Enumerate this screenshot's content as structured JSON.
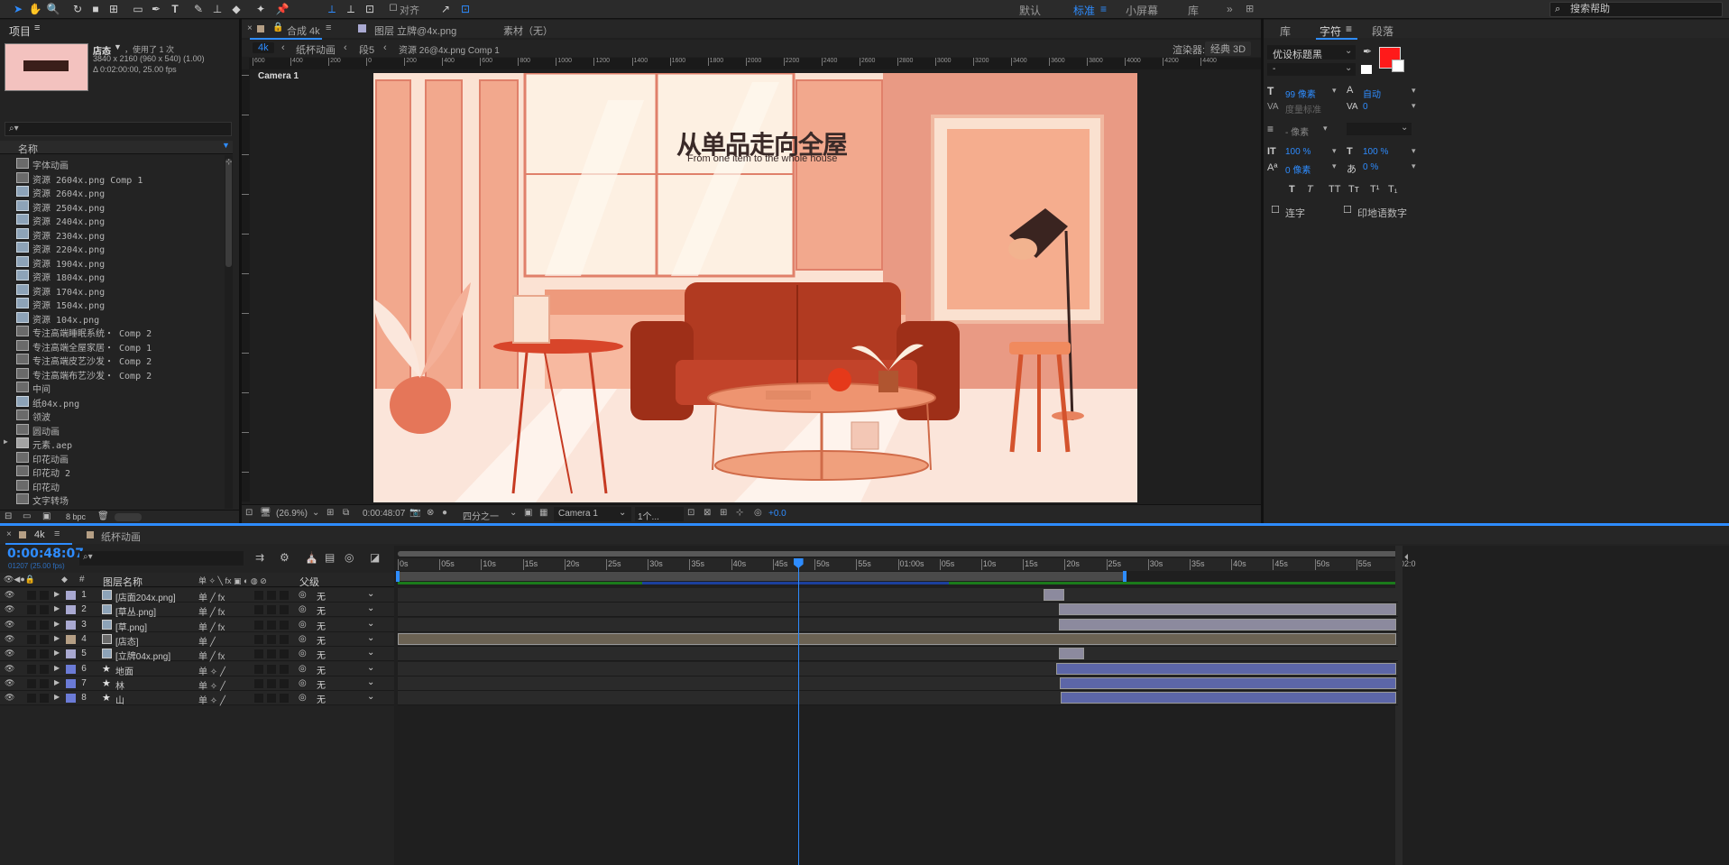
{
  "toolbar": {
    "snap_label": "对齐",
    "workspaces": [
      "默认",
      "标准",
      "小屏幕",
      "库"
    ],
    "active_workspace": "标准",
    "help_placeholder": "搜索帮助"
  },
  "project": {
    "title": "项目",
    "item_name": "店态",
    "usage": "，使用了 1 次",
    "dimensions": "3840 x 2160 (960 x 540) (1.00)",
    "duration": "Δ 0:02:00:00, 25.00 fps",
    "col_name": "名称",
    "bpc": "8 bpc",
    "items": [
      {
        "name": "字体动画",
        "type": "comp"
      },
      {
        "name": "资源 2604x.png Comp 1",
        "type": "comp"
      },
      {
        "name": "资源 2604x.png",
        "type": "img"
      },
      {
        "name": "资源 2504x.png",
        "type": "img"
      },
      {
        "name": "资源 2404x.png",
        "type": "img"
      },
      {
        "name": "资源 2304x.png",
        "type": "img"
      },
      {
        "name": "资源 2204x.png",
        "type": "img"
      },
      {
        "name": "资源 1904x.png",
        "type": "img"
      },
      {
        "name": "资源 1804x.png",
        "type": "img"
      },
      {
        "name": "资源 1704x.png",
        "type": "img"
      },
      {
        "name": "资源 1504x.png",
        "type": "img"
      },
      {
        "name": "资源 104x.png",
        "type": "img"
      },
      {
        "name": "专注高端睡眠系统・ Comp 2",
        "type": "comp"
      },
      {
        "name": "专注高端全屋家居・ Comp 1",
        "type": "comp"
      },
      {
        "name": "专注高端皮艺沙发・ Comp 2",
        "type": "comp"
      },
      {
        "name": "专注高端布艺沙发・ Comp 2",
        "type": "comp"
      },
      {
        "name": "中间",
        "type": "comp"
      },
      {
        "name": "纸04x.png",
        "type": "img"
      },
      {
        "name": "领波",
        "type": "comp"
      },
      {
        "name": "圆动画",
        "type": "comp"
      },
      {
        "name": "元素.aep",
        "type": "folder"
      },
      {
        "name": "印花动画",
        "type": "comp"
      },
      {
        "name": "印花动 2",
        "type": "comp"
      },
      {
        "name": "印花动",
        "type": "comp"
      },
      {
        "name": "文字转场",
        "type": "comp"
      }
    ]
  },
  "viewer": {
    "comp_tab": "合成 4k",
    "layer_tab": "图层 立牌@4x.png",
    "footage_tab": "素材（无）",
    "breadcrumbs": [
      "4k",
      "纸杯动画",
      "段5",
      "资源 26@4x.png Comp 1"
    ],
    "renderer_label": "渲染器:",
    "renderer_value": "经典 3D",
    "camera_label": "Camera 1",
    "ruler_h": [
      "600",
      "400",
      "200",
      "0",
      "200",
      "400",
      "600",
      "800",
      "1000",
      "1200",
      "1400",
      "1600",
      "1800",
      "2000",
      "2200",
      "2400",
      "2600",
      "2800",
      "3000",
      "3200",
      "3400",
      "3600",
      "3800",
      "4000",
      "4200",
      "4400"
    ],
    "ruler_v": [
      "0",
      "200",
      "400",
      "600",
      "800",
      "1000",
      "1200",
      "1400",
      "1600",
      "1800",
      "2000"
    ],
    "canvas_title": "从单品走向全屋",
    "canvas_subtitle": "From one item to the whole house",
    "zoom": "(26.9%)",
    "timecode": "0:00:48:07",
    "resolution": "四分之一",
    "view_camera": "Camera 1",
    "views": "1个...",
    "exposure": "+0.0"
  },
  "right_panel": {
    "tabs": [
      "库",
      "字符",
      "段落"
    ],
    "font": "优设标题黑",
    "font_style": "-",
    "font_size": "99 像素",
    "leading": "自动",
    "kerning": "度量标准",
    "tracking": "0",
    "stroke": "- 像素",
    "v_scale": "100 %",
    "h_scale": "100 %",
    "baseline": "0 像素",
    "tsume": "0 %",
    "styles": [
      "T",
      "T",
      "TT",
      "Tт",
      "T¹",
      "T₁"
    ],
    "ligatures": "连字",
    "hindi_digits": "印地语数字",
    "fill_color": "#ff1a1a"
  },
  "timeline": {
    "tabs": [
      "4k",
      "纸杯动画"
    ],
    "timecode": "0:00:48:07",
    "frame_info": "01207 (25.00 fps)",
    "col_num": "#",
    "col_name": "图层名称",
    "col_switches": "单 ✧ ╲ fx ▣ ◐ ◍ ⊘",
    "col_parent": "父级",
    "time_labels": [
      "0s",
      "05s",
      "10s",
      "15s",
      "20s",
      "25s",
      "30s",
      "35s",
      "40s",
      "45s",
      "50s",
      "55s",
      "01:00s",
      "05s",
      "10s",
      "15s",
      "20s",
      "25s",
      "30s",
      "35s",
      "40s",
      "45s",
      "50s",
      "55s",
      "02:0"
    ],
    "playhead_fraction": 0.4,
    "layers": [
      {
        "num": "1",
        "name": "[店面204x.png]",
        "type": "img",
        "color": "#a9a9d1",
        "fx": true,
        "parent": "无",
        "bar_start": 0.646,
        "bar_end": 0.666
      },
      {
        "num": "2",
        "name": "[草丛.png]",
        "type": "img",
        "color": "#a9a9d1",
        "fx": true,
        "parent": "无",
        "bar_start": 0.661,
        "bar_end": 0.998
      },
      {
        "num": "3",
        "name": "[草.png]",
        "type": "img",
        "color": "#a9a9d1",
        "fx": true,
        "parent": "无",
        "bar_start": 0.661,
        "bar_end": 0.998
      },
      {
        "num": "4",
        "name": "[店态]",
        "type": "comp",
        "color": "#b59f85",
        "fx": false,
        "parent": "无",
        "bar_start": 0.0,
        "bar_end": 0.998
      },
      {
        "num": "5",
        "name": "[立牌04x.png]",
        "type": "img",
        "color": "#a9a9d1",
        "fx": true,
        "parent": "无",
        "bar_start": 0.661,
        "bar_end": 0.686
      },
      {
        "num": "6",
        "name": "地面",
        "type": "shape",
        "color": "#6b7bd6",
        "fx": false,
        "parent": "无",
        "bar_start": 0.658,
        "bar_end": 0.998
      },
      {
        "num": "7",
        "name": "林",
        "type": "shape",
        "color": "#6b7bd6",
        "fx": false,
        "parent": "无",
        "bar_start": 0.662,
        "bar_end": 0.998
      },
      {
        "num": "8",
        "name": "山",
        "type": "shape",
        "color": "#6b7bd6",
        "fx": false,
        "parent": "无",
        "bar_start": 0.663,
        "bar_end": 0.998
      }
    ]
  }
}
